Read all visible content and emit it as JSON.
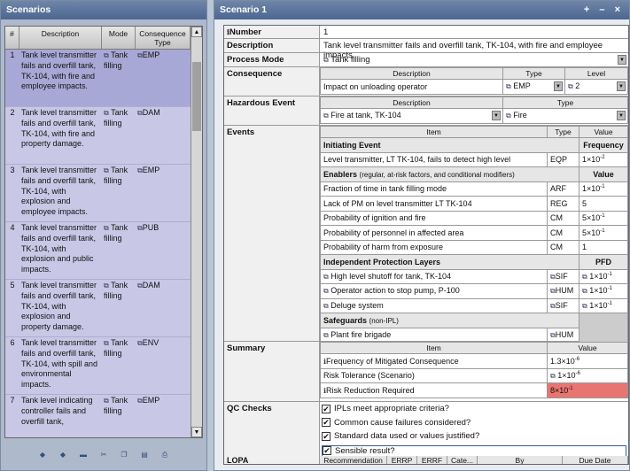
{
  "left": {
    "title": "Scenarios",
    "headers": [
      "#",
      "Description",
      "Mode",
      "Consequence Type"
    ],
    "rows": [
      {
        "n": "1",
        "desc": "Tank level transmitter fails and overfill tank, TK-104, with fire and employee impacts.",
        "mode": "Tank filling",
        "type": "EMP"
      },
      {
        "n": "2",
        "desc": "Tank level transmitter fails and overfill tank, TK-104, with fire and property damage.",
        "mode": "Tank filling",
        "type": "DAM"
      },
      {
        "n": "3",
        "desc": "Tank level transmitter fails and overfill tank, TK-104, with explosion and employee impacts.",
        "mode": "Tank filling",
        "type": "EMP"
      },
      {
        "n": "4",
        "desc": "Tank level transmitter fails and overfill tank, TK-104, with explosion and public impacts.",
        "mode": "Tank filling",
        "type": "PUB"
      },
      {
        "n": "5",
        "desc": "Tank level transmitter fails and overfill tank, TK-104, with explosion and property damage.",
        "mode": "Tank filling",
        "type": "DAM"
      },
      {
        "n": "6",
        "desc": "Tank level transmitter fails and overfill tank, TK-104, with spill and environmental impacts.",
        "mode": "Tank filling",
        "type": "ENV"
      },
      {
        "n": "7",
        "desc": "Tank level indicating controller fails and overfill tank,",
        "mode": "Tank filling",
        "type": "EMP"
      }
    ]
  },
  "right": {
    "title": "Scenario 1",
    "window_controls": "+ – ×",
    "number_label": "Number",
    "number": "1",
    "description_label": "Description",
    "description": "Tank level transmitter fails and overfill tank, TK-104, with fire and employee impacts.",
    "mode_label": "Process Mode",
    "mode": "Tank filling",
    "consequence_label": "Consequence",
    "cons_headers": [
      "Description",
      "Type",
      "Level"
    ],
    "cons": {
      "desc": "Impact on unloading operator",
      "type": "EMP",
      "level": "2"
    },
    "hazard_label": "Hazardous Event",
    "haz_headers": [
      "Description",
      "Type"
    ],
    "haz": {
      "desc": "Fire at tank, TK-104",
      "type": "Fire"
    },
    "events_label": "Events",
    "ev_headers": [
      "Item",
      "Type",
      "Value"
    ],
    "initiating_label": "Initiating Event",
    "frequency_label": "Frequency",
    "initiating": {
      "item": "Level transmitter, LT TK-104, fails to detect high level",
      "type": "EQP",
      "value": "1×10",
      "exp": "-2"
    },
    "enablers_label": "Enablers",
    "enablers_note": "(regular, at-risk factors, and conditional modifiers)",
    "value_label": "Value",
    "enablers": [
      {
        "item": "Fraction of time in tank filling mode",
        "type": "ARF",
        "value": "1×10",
        "exp": "-1"
      },
      {
        "item": "Lack of PM on level transmitter LT TK-104",
        "type": "REG",
        "value": "5",
        "exp": ""
      },
      {
        "item": "Probability of ignition and fire",
        "type": "CM",
        "value": "5×10",
        "exp": "-1"
      },
      {
        "item": "Probability of personnel in affected area",
        "type": "CM",
        "value": "5×10",
        "exp": "-1"
      },
      {
        "item": "Probability of harm from exposure",
        "type": "CM",
        "value": "1",
        "exp": ""
      }
    ],
    "ipl_label": "Independent Protection Layers",
    "pfd_label": "PFD",
    "ipls": [
      {
        "item": "High level shutoff for tank, TK-104",
        "type": "SIF",
        "value": "1×10",
        "exp": "-1"
      },
      {
        "item": "Operator action to stop pump, P-100",
        "type": "HUM",
        "value": "1×10",
        "exp": "-1"
      },
      {
        "item": "Deluge system",
        "type": "SIF",
        "value": "1×10",
        "exp": "-1"
      }
    ],
    "safeguards_label": "Safeguards",
    "safeguards_note": "(non-IPL)",
    "safeguard": {
      "item": "Plant fire brigade",
      "type": "HUM"
    },
    "summary_label": "Summary",
    "sum_headers": [
      "Item",
      "Value"
    ],
    "summary": [
      {
        "item": "Frequency of Mitigated Consequence",
        "value": "1.3×10",
        "exp": "-6"
      },
      {
        "item": "Risk Tolerance (Scenario)",
        "value": "1×10",
        "exp": "-6"
      },
      {
        "item": "Risk Reduction Required",
        "value": "8×10",
        "exp": "-1"
      }
    ],
    "qc_label": "QC Checks",
    "qc": [
      "IPLs meet appropriate criteria?",
      "Common cause failures considered?",
      "Standard data used or values justified?",
      "Sensible result?"
    ],
    "lopa_label": "LOPA Recommendations",
    "lopa_headers": [
      "Recommendation",
      "ERRP",
      "ERRF",
      "Cate...",
      "By",
      "Due Date"
    ],
    "colors": {
      "highlight_red": "#e87570",
      "title_blue": "#4c6690"
    }
  }
}
